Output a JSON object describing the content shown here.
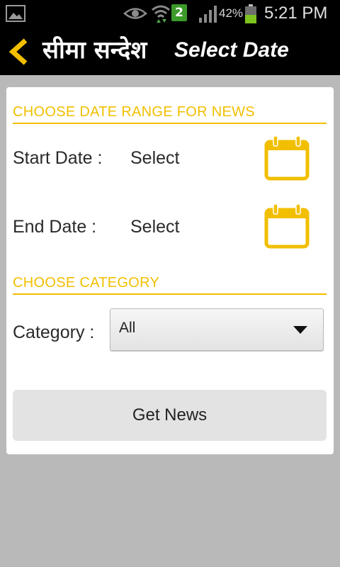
{
  "status_bar": {
    "notification_badge": "2",
    "battery_percent": "42%",
    "time": "5:21 PM",
    "icons": [
      "gallery-icon",
      "eye-icon",
      "wifi-icon",
      "signal-icon",
      "battery-icon"
    ]
  },
  "action_bar": {
    "brand": "सीमा सन्देश",
    "title": "Select Date",
    "back_icon": "chevron-left-icon"
  },
  "date_section": {
    "header": "CHOOSE DATE RANGE FOR NEWS",
    "start_label": "Start Date :",
    "start_value": "Select",
    "end_label": "End Date :",
    "end_value": "Select"
  },
  "category_section": {
    "header": "CHOOSE CATEGORY",
    "label": "Category :",
    "selected": "All"
  },
  "actions": {
    "get_news": "Get News"
  },
  "colors": {
    "accent": "#f2bf00",
    "action_bar": "#000000",
    "background": "#b9b9b9",
    "card": "#ffffff",
    "button": "#e3e3e3"
  }
}
